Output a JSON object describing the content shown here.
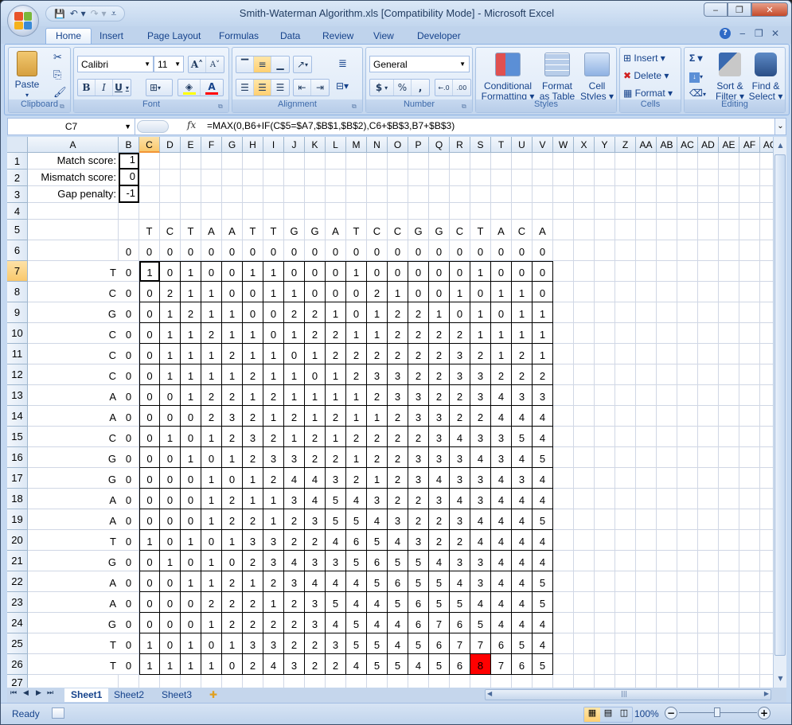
{
  "window": {
    "title": "Smith-Waterman Algorithm.xls  [Compatibility Mode] - Microsoft Excel",
    "minimize": "‒",
    "restore": "❐",
    "close": "✕"
  },
  "qat": {
    "save": "💾",
    "undo": "↶ ▾",
    "redo": "↷ ▾",
    "customize": "⩡"
  },
  "tabs": [
    "Home",
    "Insert",
    "Page Layout",
    "Formulas",
    "Data",
    "Review",
    "View",
    "Developer"
  ],
  "ribbon_right": {
    "help": "?",
    "minimize": "‒",
    "restore": "❐",
    "close": "✕"
  },
  "ribbon": {
    "clipboard": {
      "label": "Clipboard",
      "paste": "Paste"
    },
    "font": {
      "label": "Font",
      "name": "Calibri",
      "size": "11",
      "grow": "A˄",
      "shrink": "A˅",
      "bold": "B",
      "italic": "I",
      "underline": "U",
      "fill_color": "#ffff00",
      "font_color": "#ff0000"
    },
    "alignment": {
      "label": "Alignment"
    },
    "number": {
      "label": "Number",
      "format": "General",
      "currency": "$",
      "percent": "%",
      "comma": ",",
      "inc_decimal": "←.0 .00",
      "dec_decimal": ".00 →.0"
    },
    "styles": {
      "label": "Styles",
      "conditional": [
        "Conditional",
        "Formatting ▾"
      ],
      "format_table": [
        "Format",
        "as Table ▾"
      ],
      "cell_styles": [
        "Cell",
        "Styles ▾"
      ]
    },
    "cells": {
      "label": "Cells",
      "insert": "Insert ▾",
      "delete": "Delete ▾",
      "format": "Format ▾"
    },
    "editing": {
      "label": "Editing",
      "autosum": "Σ ▾",
      "fill": "▾",
      "clear": "▾",
      "sort": [
        "Sort &",
        "Filter ▾"
      ],
      "find": [
        "Find &",
        "Select ▾"
      ]
    }
  },
  "formula_bar": {
    "name_box": "C7",
    "fx": "fx",
    "formula": "=MAX(0,B6+IF(C$5=$A7,$B$1,$B$2),C6+$B$3,B7+$B$3)"
  },
  "columns": [
    "A",
    "B",
    "C",
    "D",
    "E",
    "F",
    "G",
    "H",
    "I",
    "J",
    "K",
    "L",
    "M",
    "N",
    "O",
    "P",
    "Q",
    "R",
    "S",
    "T",
    "U",
    "V",
    "W",
    "X",
    "Y",
    "Z",
    "AA",
    "AB",
    "AC",
    "AD",
    "AE",
    "AF",
    "AG"
  ],
  "selected_column": "C",
  "selected_row": 7,
  "rows": [
    1,
    2,
    3,
    4,
    5,
    6,
    7,
    8,
    9,
    10,
    11,
    12,
    13,
    14,
    15,
    16,
    17,
    18,
    19,
    20,
    21,
    22,
    23,
    24,
    25,
    26,
    27
  ],
  "params": [
    {
      "label": "Match score:",
      "value": "1"
    },
    {
      "label": "Mismatch score:",
      "value": "0"
    },
    {
      "label": "Gap penalty:",
      "value": "-1"
    }
  ],
  "sequence_top": [
    "T",
    "C",
    "T",
    "A",
    "A",
    "T",
    "T",
    "G",
    "G",
    "A",
    "T",
    "C",
    "C",
    "G",
    "G",
    "C",
    "T",
    "A",
    "C",
    "A"
  ],
  "sequence_left": [
    "T",
    "C",
    "G",
    "C",
    "C",
    "C",
    "A",
    "A",
    "C",
    "G",
    "G",
    "A",
    "A",
    "T",
    "G",
    "A",
    "A",
    "G",
    "T",
    "T"
  ],
  "row6_values": [
    "0",
    "0",
    "0",
    "0",
    "0",
    "0",
    "0",
    "0",
    "0",
    "0",
    "0",
    "0",
    "0",
    "0",
    "0",
    "0",
    "0",
    "0",
    "0",
    "0",
    "0"
  ],
  "column_b_values": [
    "0",
    "0",
    "0",
    "0",
    "0",
    "0",
    "0",
    "0",
    "0",
    "0",
    "0",
    "0",
    "0",
    "0",
    "0",
    "0",
    "0",
    "0",
    "0",
    "0"
  ],
  "matrix": [
    [
      1,
      0,
      1,
      0,
      0,
      1,
      1,
      0,
      0,
      0,
      1,
      0,
      0,
      0,
      0,
      0,
      1,
      0,
      0,
      0
    ],
    [
      0,
      2,
      1,
      1,
      0,
      0,
      1,
      1,
      0,
      0,
      0,
      2,
      1,
      0,
      0,
      1,
      0,
      1,
      1,
      0
    ],
    [
      0,
      1,
      2,
      1,
      1,
      0,
      0,
      2,
      2,
      1,
      0,
      1,
      2,
      2,
      1,
      0,
      1,
      0,
      1,
      1
    ],
    [
      0,
      1,
      1,
      2,
      1,
      1,
      0,
      1,
      2,
      2,
      1,
      1,
      2,
      2,
      2,
      2,
      1,
      1,
      1,
      1
    ],
    [
      0,
      1,
      1,
      1,
      2,
      1,
      1,
      0,
      1,
      2,
      2,
      2,
      2,
      2,
      2,
      3,
      2,
      1,
      2,
      1
    ],
    [
      0,
      1,
      1,
      1,
      1,
      2,
      1,
      1,
      0,
      1,
      2,
      3,
      3,
      2,
      2,
      3,
      3,
      2,
      2,
      2
    ],
    [
      0,
      0,
      1,
      2,
      2,
      1,
      2,
      1,
      1,
      1,
      1,
      2,
      3,
      3,
      2,
      2,
      3,
      4,
      3,
      3
    ],
    [
      0,
      0,
      0,
      2,
      3,
      2,
      1,
      2,
      1,
      2,
      1,
      1,
      2,
      3,
      3,
      2,
      2,
      4,
      4,
      4
    ],
    [
      0,
      1,
      0,
      1,
      2,
      3,
      2,
      1,
      2,
      1,
      2,
      2,
      2,
      2,
      3,
      4,
      3,
      3,
      5,
      4
    ],
    [
      0,
      0,
      1,
      0,
      1,
      2,
      3,
      3,
      2,
      2,
      1,
      2,
      2,
      3,
      3,
      3,
      4,
      3,
      4,
      5
    ],
    [
      0,
      0,
      0,
      1,
      0,
      1,
      2,
      4,
      4,
      3,
      2,
      1,
      2,
      3,
      4,
      3,
      3,
      4,
      3,
      4
    ],
    [
      0,
      0,
      0,
      1,
      2,
      1,
      1,
      3,
      4,
      5,
      4,
      3,
      2,
      2,
      3,
      4,
      3,
      4,
      4,
      4
    ],
    [
      0,
      0,
      0,
      1,
      2,
      2,
      1,
      2,
      3,
      5,
      5,
      4,
      3,
      2,
      2,
      3,
      4,
      4,
      4,
      5
    ],
    [
      1,
      0,
      1,
      0,
      1,
      3,
      3,
      2,
      2,
      4,
      6,
      5,
      4,
      3,
      2,
      2,
      4,
      4,
      4,
      4
    ],
    [
      0,
      1,
      0,
      1,
      0,
      2,
      3,
      4,
      3,
      3,
      5,
      6,
      5,
      5,
      4,
      3,
      3,
      4,
      4,
      4
    ],
    [
      0,
      0,
      1,
      1,
      2,
      1,
      2,
      3,
      4,
      4,
      4,
      5,
      6,
      5,
      5,
      4,
      3,
      4,
      4,
      5
    ],
    [
      0,
      0,
      0,
      2,
      2,
      2,
      1,
      2,
      3,
      5,
      4,
      4,
      5,
      6,
      5,
      5,
      4,
      4,
      4,
      5
    ],
    [
      0,
      0,
      0,
      1,
      2,
      2,
      2,
      2,
      3,
      4,
      5,
      4,
      4,
      6,
      7,
      6,
      5,
      4,
      4,
      4
    ],
    [
      1,
      0,
      1,
      0,
      1,
      3,
      3,
      2,
      2,
      3,
      5,
      5,
      4,
      5,
      6,
      7,
      7,
      6,
      5,
      4
    ],
    [
      1,
      1,
      1,
      1,
      0,
      2,
      4,
      3,
      2,
      2,
      4,
      5,
      5,
      4,
      5,
      6,
      8,
      7,
      6,
      5
    ]
  ],
  "highlight": {
    "row": 19,
    "col": 16,
    "color": "#ff0000"
  },
  "sheets": [
    "Sheet1",
    "Sheet2",
    "Sheet3"
  ],
  "active_sheet": "Sheet1",
  "status": {
    "ready": "Ready",
    "zoom": "100%",
    "zoom_out": "−",
    "zoom_in": "+"
  }
}
